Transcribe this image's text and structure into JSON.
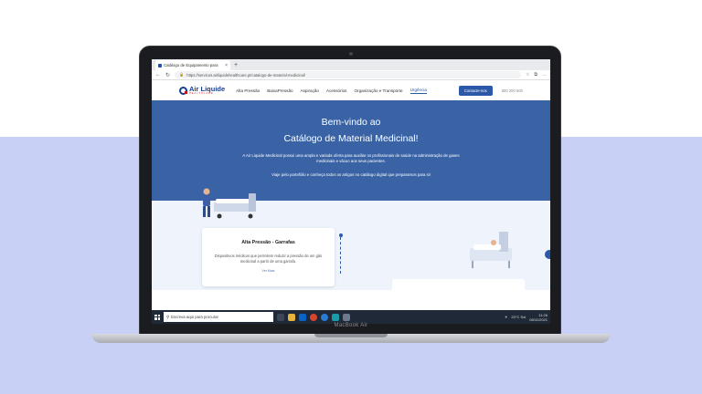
{
  "browser": {
    "tab_title": "Catálogo de Equipamento para",
    "tab_close": "×",
    "new_tab": "+",
    "url": "https://servicos.airliquidehealthcare.pt/catalogo-de-material-medicinal/"
  },
  "site": {
    "logo_name": "Air Liquide",
    "logo_sub": "HEALTHCARE",
    "menu": [
      "Alta Pressão",
      "BaixaPressão",
      "Aspiração",
      "Acessórios",
      "Organização e Transporte",
      "Urgência"
    ],
    "cta": "Contacte-nos",
    "phone": "800 200 500"
  },
  "hero": {
    "title_line1": "Bem-vindo ao",
    "title_line2": "Catálogo de Material Medicinal!",
    "paragraph1": "A Air Liquide Medicinal possui uma ampla e variada oferta para auxiliar os profissionais de saúde na administração de gases medicinais e vácuo aos seus pacientes.",
    "paragraph2": "Viaje pelo portefólio e conheça todos os artigos no catálogo digital que preparamos para si!"
  },
  "card": {
    "title": "Alta Pressão - Garrafas",
    "text": "Dispositivos médicos que permitem reduzir a pressão de um gás medicinal a partir de uma garrafa.",
    "more": "Ver Mais"
  },
  "taskbar": {
    "search_placeholder": "Escreva aqui para procurar",
    "weather": "20°C  Sol",
    "time": "11:26",
    "date": "08/11/2021"
  },
  "device": {
    "brand": "MacBook Air"
  },
  "colors": {
    "hero": "#3a63a6",
    "accent": "#2b58a8",
    "background_lower": "#c9d0f6"
  }
}
